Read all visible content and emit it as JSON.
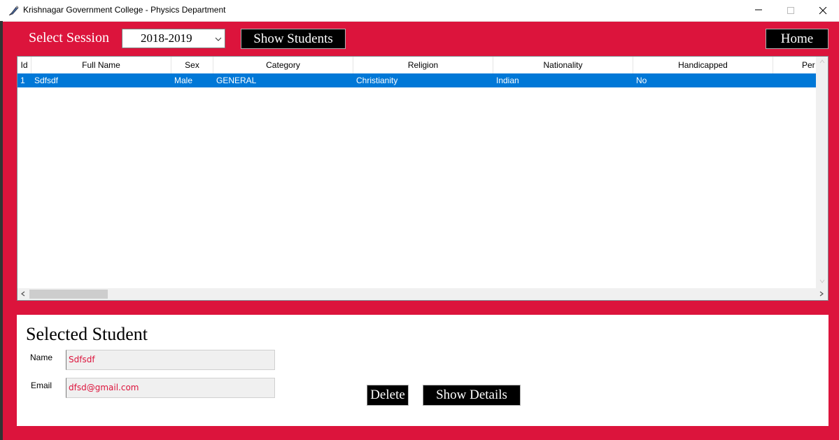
{
  "window": {
    "title": "Krishnagar Government College - Physics Department",
    "app_icon": "pen-icon",
    "controls": [
      "minimize-icon",
      "maximize-icon",
      "close-icon"
    ]
  },
  "toolbar": {
    "session_label": "Select Session",
    "session_value": "2018-2019",
    "show_students_label": "Show Students",
    "home_label": "Home"
  },
  "table": {
    "columns": [
      "Id",
      "Full Name",
      "Sex",
      "Category",
      "Religion",
      "Nationality",
      "Handicapped",
      "Per"
    ],
    "rows": [
      [
        "1",
        "Sdfsdf",
        "Male",
        "GENERAL",
        "Christianity",
        "Indian",
        "No",
        ""
      ]
    ],
    "selected_row_color": "#0078d7"
  },
  "selected_student": {
    "title": "Selected Student",
    "name_label": "Name",
    "name_value": "Sdfsdf",
    "email_label": "Email",
    "email_value": "dfsd@gmail.com",
    "delete_label": "Delete",
    "show_details_label": "Show Details"
  },
  "colors": {
    "background": "#dc143c",
    "button": "#000000",
    "field_text": "#dc143c"
  }
}
